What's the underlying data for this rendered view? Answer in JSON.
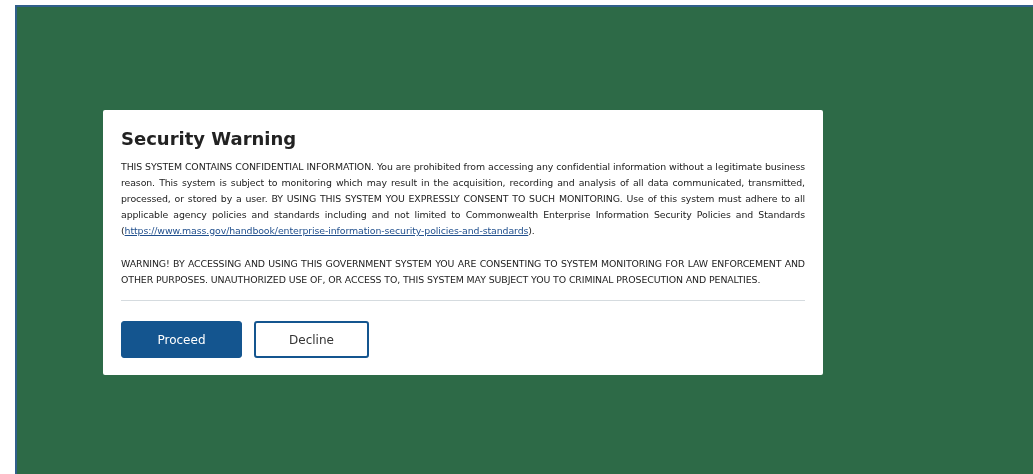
{
  "dialog": {
    "title": "Security Warning",
    "paragraphs": [
      {
        "text": "THIS SYSTEM CONTAINS CONFIDENTIAL INFORMATION. You are prohibited from accessing any confidential information without a legitimate business reason. This system is subject to monitoring which may result in the acquisition, recording and analysis of all data communicated, transmitted, processed, or stored by a user. BY USING THIS SYSTEM YOU EXPRESSLY CONSENT TO SUCH MONITORING. Use of this system must adhere to all applicable agency policies and standards including and not limited to Commonwealth Enterprise Information Security Policies and Standards (",
        "link": "https://www.mass.gov/handbook/enterprise-information-security-policies-and-standards",
        "text_after": ")."
      },
      {
        "text": "WARNING! BY ACCESSING AND USING THIS GOVERNMENT SYSTEM YOU ARE CONSENTING TO SYSTEM MONITORING FOR LAW ENFORCEMENT AND OTHER PURPOSES. UNAUTHORIZED USE OF, OR ACCESS TO, THIS SYSTEM MAY SUBJECT YOU TO CRIMINAL PROSECUTION AND PENALTIES."
      }
    ],
    "buttons": [
      {
        "label": "Proceed",
        "kind": "primary"
      },
      {
        "label": "Decline",
        "kind": "secondary"
      }
    ]
  }
}
